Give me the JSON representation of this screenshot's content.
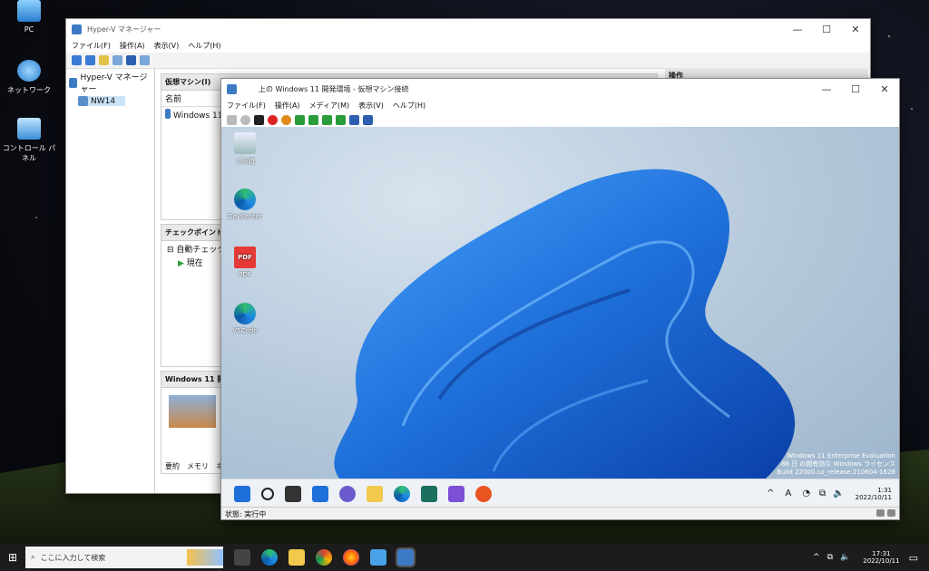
{
  "desktop": {
    "icons": [
      {
        "label": "PC"
      },
      {
        "label": "ネットワーク"
      },
      {
        "label": "コントロール パネル"
      }
    ]
  },
  "hyperv": {
    "title": "Hyper-V マネージャー",
    "menu": [
      "ファイル(F)",
      "操作(A)",
      "表示(V)",
      "ヘルプ(H)"
    ],
    "tree": {
      "root": "Hyper-V マネージャー",
      "server": "NW14"
    },
    "vm_pane": {
      "header": "仮想マシン(I)",
      "col_name": "名前",
      "row": "Windows 11 開発"
    },
    "checkpoint_pane": {
      "header": "チェックポイント(C)",
      "item1": "自動チェックポ",
      "item2": "現在"
    },
    "detail_pane": {
      "header": "Windows 11 開発環",
      "tabs": [
        "要約",
        "メモリ",
        "ネ"
      ]
    },
    "action_pane": {
      "header": "操作"
    }
  },
  "vmconnect": {
    "title": "上の Windows 11 開発環境 - 仮想マシン接続",
    "menu": [
      "ファイル(F)",
      "操作(A)",
      "メディア(M)",
      "表示(V)",
      "ヘルプ(H)"
    ],
    "status_label": "状態: 実行中",
    "guest": {
      "icons": [
        {
          "label": "ごみ箱"
        },
        {
          "label": "DevCenter"
        },
        {
          "label": "PDF",
          "sub": "PDF"
        },
        {
          "label": "VSCode"
        }
      ],
      "watermark": {
        "line1": "Windows 11 Enterprise Evaluation",
        "line2": "86 日 の間有効な Windows ライセンス",
        "line3": "Build 22000.co_release.210604-1628"
      },
      "clock": {
        "time": "1:31",
        "date": "2022/10/11"
      },
      "tray": "A"
    }
  },
  "taskbar": {
    "search_placeholder": "ここに入力して検索",
    "clock": {
      "time": "17:31",
      "date": "2022/10/11"
    }
  },
  "colors": {
    "accent": "#1e6fd9",
    "taskbar": "#1c1c1c"
  }
}
